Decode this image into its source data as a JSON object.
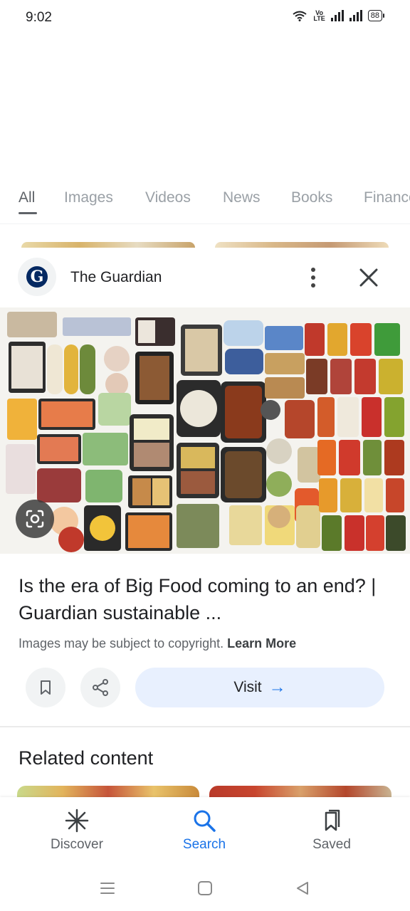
{
  "status_bar": {
    "time": "9:02",
    "volte_top": "Vo",
    "volte_bottom": "LTE",
    "battery": "88"
  },
  "tabs": [
    {
      "label": "All",
      "active": true
    },
    {
      "label": "Images"
    },
    {
      "label": "Videos"
    },
    {
      "label": "News"
    },
    {
      "label": "Books"
    },
    {
      "label": "Finance"
    }
  ],
  "source": {
    "name": "The Guardian",
    "logo_letter": "G",
    "logo_color": "#052962"
  },
  "result": {
    "title": "Is the era of Big Food coming to an end? | Guardian sustainable ...",
    "copyright": "Images may be subject to copyright.",
    "learn_more": "Learn More",
    "visit_label": "Visit",
    "visit_arrow": "→"
  },
  "related": {
    "title": "Related content"
  },
  "bottom_nav": [
    {
      "label": "Discover",
      "icon": "asterisk-icon"
    },
    {
      "label": "Search",
      "icon": "search-icon",
      "active": true
    },
    {
      "label": "Saved",
      "icon": "saved-icon"
    }
  ],
  "colors": {
    "accent": "#1a73e8",
    "visit_bg": "#e8f0fe",
    "muted": "#9aa0a6"
  }
}
